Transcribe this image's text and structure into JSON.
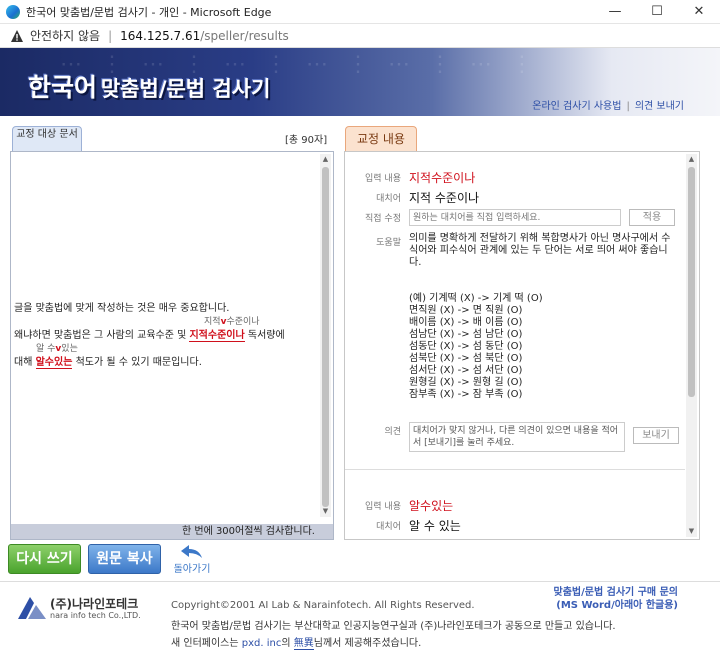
{
  "window": {
    "title": "한국어 맞춤법/문법 검사기 - 개인 - Microsoft Edge",
    "minimize": "—",
    "maximize": "☐",
    "close": "✕"
  },
  "address": {
    "security_label": "안전하지 않음",
    "separator": "|",
    "host": "164.125.7.61",
    "path": "/speller/results"
  },
  "banner": {
    "title_part1": "한국어",
    "title_part2": "맞춤법/문법 검사기",
    "link_manual": "온라인 검사기 사용법",
    "link_sep": "|",
    "link_feedback": "의견 보내기"
  },
  "left": {
    "tab_label": "교정 대상 문서",
    "char_count": "[총 90자]",
    "line1": "글을 맞춤법에 맞게 작성하는 것은 매우 중요합니다.",
    "line2_before": "왜냐하면 맞춤법은 그 사람의 교육수준 및 ",
    "line2_error": "지적수준이나",
    "line2_after": " 독서량에",
    "line2_hint_a": "지적",
    "line2_hint_b": "수준이나",
    "line3_before": "대해 ",
    "line3_error": "알수있는",
    "line3_after": " 척도가 될 수 있기 때문입니다.",
    "line3_hint_a": "알 수",
    "line3_hint_b": "있는",
    "footer": "한 번에 300어절씩 검사합니다."
  },
  "right": {
    "tab_label": "교정 내용",
    "labels": {
      "input": "입력 내용",
      "replacement": "대치어",
      "direct": "직접 수정",
      "help": "도움말",
      "opinion": "의견"
    },
    "item1": {
      "input": "지적수준이나",
      "replacement": "지적 수준이나",
      "direct_placeholder": "원하는 대치어를 직접 입력하세요.",
      "apply_button": "적용",
      "help_main": "의미를 명확하게 전달하기 위해 복합명사가 아닌 명사구에서 수식어와 피수식어 관계에 있는 두 단어는 서로 띄어 써야 좋습니다.",
      "examples": [
        "(예) 기계떡 (X) -> 기계 떡 (O)",
        "면직원 (X) -> 면 직원 (O)",
        "배이름 (X) -> 배 이름 (O)",
        "섬남단 (X) -> 섬 남단 (O)",
        "섬동단 (X) -> 섬 동단 (O)",
        "섬북단 (X) -> 섬 북단 (O)",
        "섬서단 (X) -> 섬 서단 (O)",
        "원형길 (X) -> 원형 길 (O)",
        "잠부족 (X) -> 잠 부족 (O)"
      ],
      "opinion_placeholder": "대치어가 맞지 않거나, 다른 의견이 있으면 내용을 적어서 [보내기]를 눌러 주세요.",
      "send_button": "보내기"
    },
    "item2": {
      "input": "알수있는",
      "replacement": "알 수 있는"
    }
  },
  "buttons": {
    "rewrite": "다시 쓰기",
    "copy": "원문 복사",
    "back": "돌아가기"
  },
  "footer": {
    "logo_korean": "(주)나라인포테크",
    "logo_english": "nara info tech Co.,LTD.",
    "copyright": "Copyright©2001 AI Lab & Narainfotech. All Rights Reserved.",
    "line1": "한국어 맞춤법/문법 검사기는 부산대학교 인공지능연구실과 (주)나라인포테크가 공동으로 만들고 있습니다.",
    "line2_before": "새 인터페이스는 ",
    "line2_link": "pxd. inc",
    "line2_middle": "의 ",
    "line2_name": "無異",
    "line2_after": "님께서 제공해주셨습니다.",
    "buy_line1": "맞춤법/문법 검사기 구매 문의",
    "buy_line2": "(MS Word/아래아 한글용)"
  }
}
